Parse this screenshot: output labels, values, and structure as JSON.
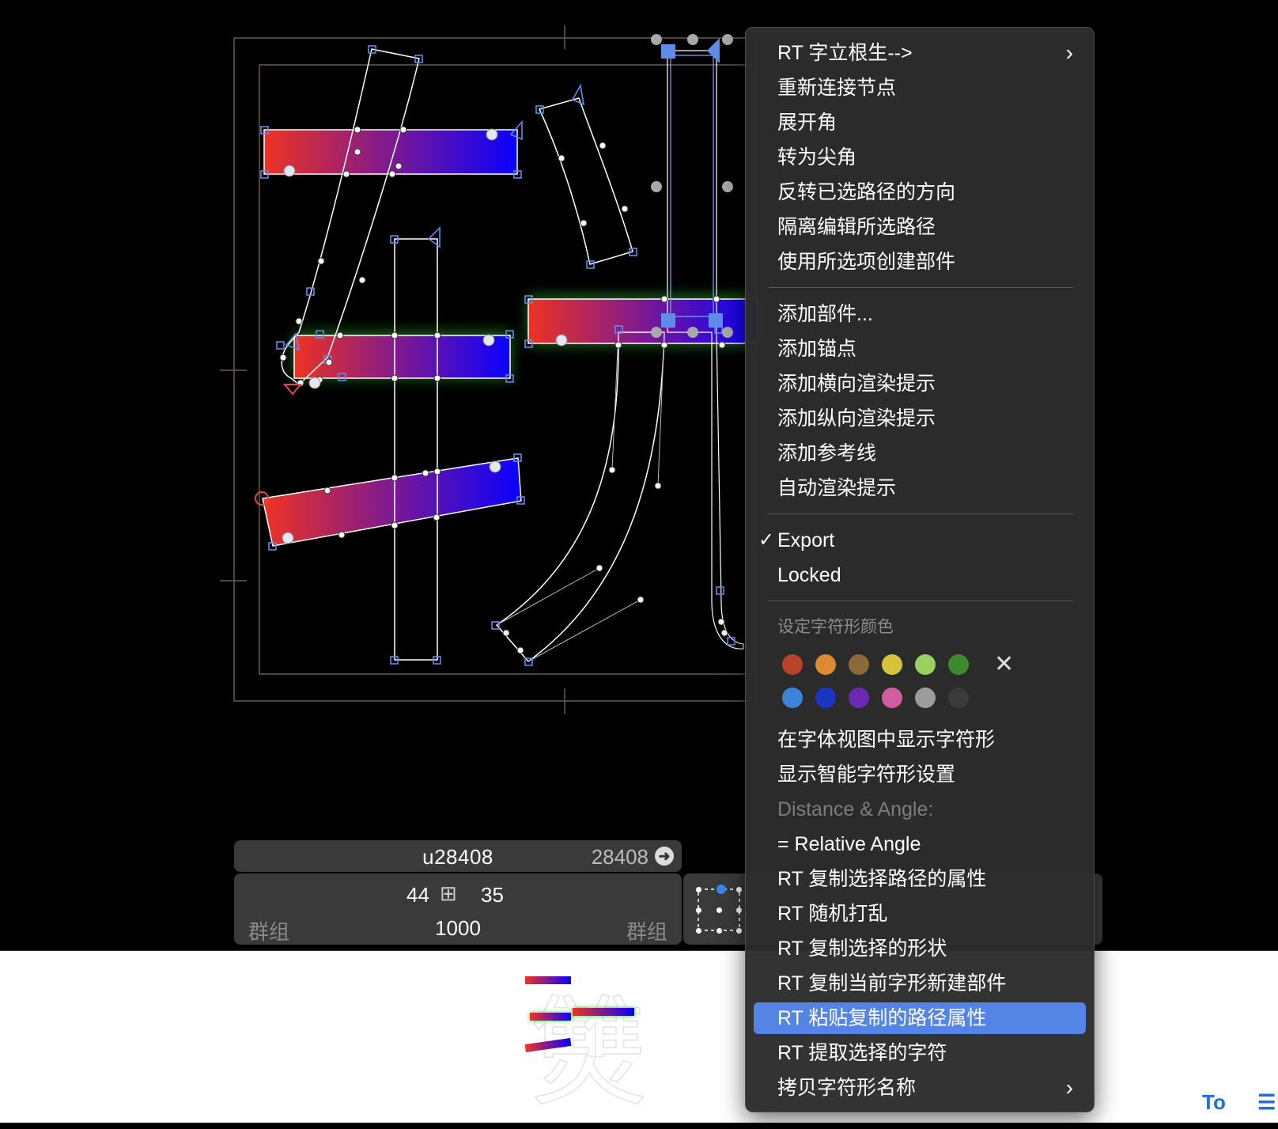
{
  "glyph": {
    "name": "u28408",
    "unicode": "28408",
    "lsb": "44",
    "rsb": "35",
    "width": "1000",
    "left_group": "群组",
    "right_group": "群组"
  },
  "preview": {
    "char": "㸈"
  },
  "icons": {
    "goto": "arrow-right-circle-icon",
    "width_icon": "metrics-width-icon",
    "text_tool": "text-tool-icon",
    "align": "align-left-icon"
  },
  "gradient": {
    "start": "#ee3322",
    "end": "#0a00ff",
    "glow": "#3bc43b",
    "handle": "#5d8ce9"
  },
  "menu": {
    "group1": [
      {
        "label": "RT 字立根生-->",
        "submenu": true
      },
      {
        "label": "重新连接节点"
      },
      {
        "label": "展开角"
      },
      {
        "label": "转为尖角"
      },
      {
        "label": "反转已选路径的方向"
      },
      {
        "label": "隔离编辑所选路径"
      },
      {
        "label": "使用所选项创建部件"
      }
    ],
    "group2": [
      {
        "label": "添加部件..."
      },
      {
        "label": "添加锚点"
      },
      {
        "label": "添加横向渲染提示"
      },
      {
        "label": "添加纵向渲染提示"
      },
      {
        "label": "添加参考线"
      },
      {
        "label": "自动渲染提示"
      }
    ],
    "group3": [
      {
        "label": "Export",
        "checked": true,
        "check_mark": "✓"
      },
      {
        "label": "Locked"
      }
    ],
    "color_header": "设定字符形颜色",
    "colors_row1": [
      "#b8432a",
      "#dd8b32",
      "#8a6a36",
      "#d5c33b",
      "#9bcf5f",
      "#3d8a2c"
    ],
    "colors_row2": [
      "#3c84d8",
      "#1a35c2",
      "#6a2ab3",
      "#d15da0",
      "#9c9c9c",
      "#3a3a3a"
    ],
    "clear_color": "✕",
    "group4": [
      {
        "label": "在字体视图中显示字符形"
      },
      {
        "label": "显示智能字符形设置"
      },
      {
        "label": "Distance & Angle:",
        "disabled": true
      },
      {
        "label": "= Relative Angle"
      },
      {
        "label": "RT 复制选择路径的属性"
      },
      {
        "label": "RT 随机打乱"
      },
      {
        "label": "RT 复制选择的形状"
      },
      {
        "label": "RT 复制当前字形新建部件"
      },
      {
        "label": "RT 粘贴复制的路径属性",
        "highlighted": true
      },
      {
        "label": "RT 提取选择的字符"
      },
      {
        "label": "拷贝字符形名称",
        "submenu": true
      }
    ],
    "submenu_arrow": "›"
  }
}
